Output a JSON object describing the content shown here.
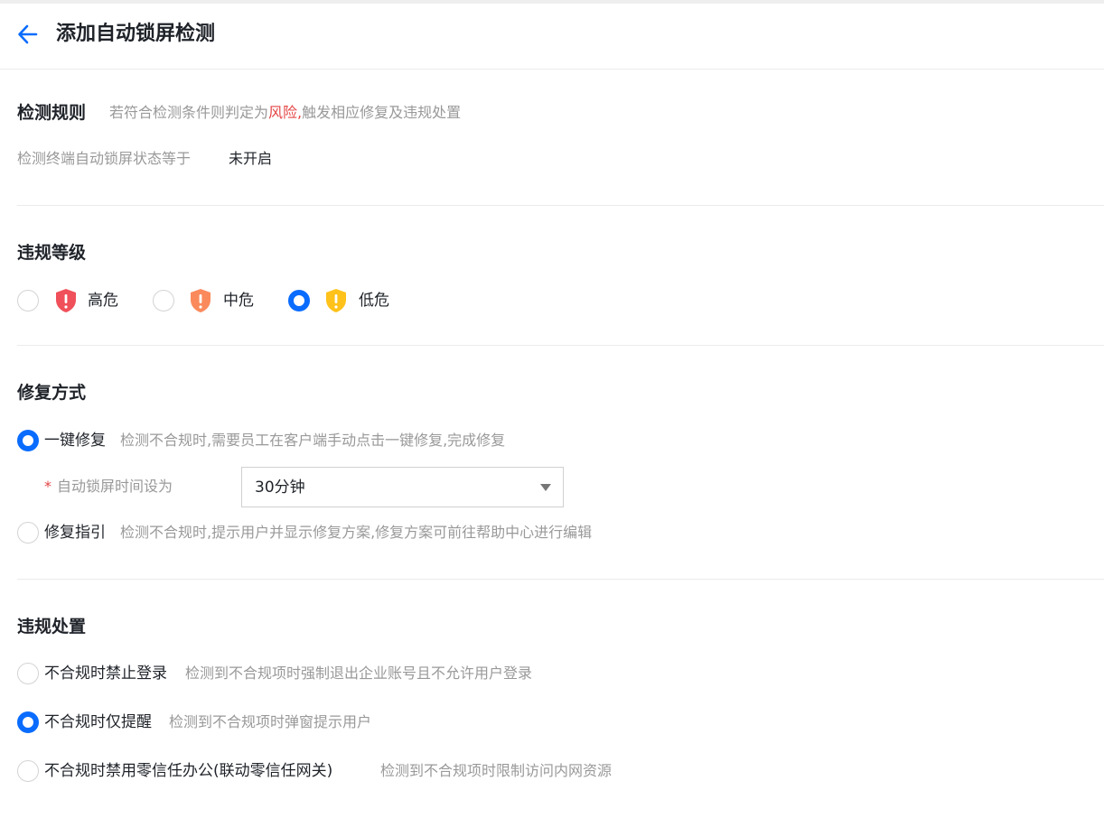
{
  "header": {
    "title": "添加自动锁屏检测",
    "back_icon": "arrow-left-icon",
    "accent_color": "#0a6cff"
  },
  "detection_rule": {
    "title": "检测规则",
    "hint_prefix": "若符合检测条件则判定为",
    "hint_risk": "风险,",
    "hint_suffix": "触发相应修复及违规处置",
    "condition_label": "检测终端自动锁屏状态等于",
    "condition_value": "未开启"
  },
  "violation_level": {
    "title": "违规等级",
    "options": [
      {
        "label": "高危",
        "icon": "shield-alert-red-icon",
        "color": "#f0505a",
        "checked": false
      },
      {
        "label": "中危",
        "icon": "shield-alert-orange-icon",
        "color": "#fa8a5c",
        "checked": false
      },
      {
        "label": "低危",
        "icon": "shield-alert-yellow-icon",
        "color": "#ffc21a",
        "checked": true
      }
    ]
  },
  "repair_method": {
    "title": "修复方式",
    "options": [
      {
        "label": "一键修复",
        "desc": "检测不合规时,需要员工在客户端手动点击一键修复,完成修复",
        "checked": true
      },
      {
        "label": "修复指引",
        "desc": "检测不合规时,提示用户并显示修复方案,修复方案可前往帮助中心进行编辑",
        "checked": false
      }
    ],
    "lock_time": {
      "required_mark": "*",
      "label": "自动锁屏时间设为",
      "selected": "30分钟"
    }
  },
  "violation_handling": {
    "title": "违规处置",
    "options": [
      {
        "label": "不合规时禁止登录",
        "desc": "检测到不合规项时强制退出企业账号且不允许用户登录",
        "checked": false
      },
      {
        "label": "不合规时仅提醒",
        "desc": "检测到不合规项时弹窗提示用户",
        "checked": true
      },
      {
        "label": "不合规时禁用零信任办公(联动零信任网关)",
        "desc": "检测到不合规项时限制访问内网资源",
        "checked": false
      }
    ]
  }
}
